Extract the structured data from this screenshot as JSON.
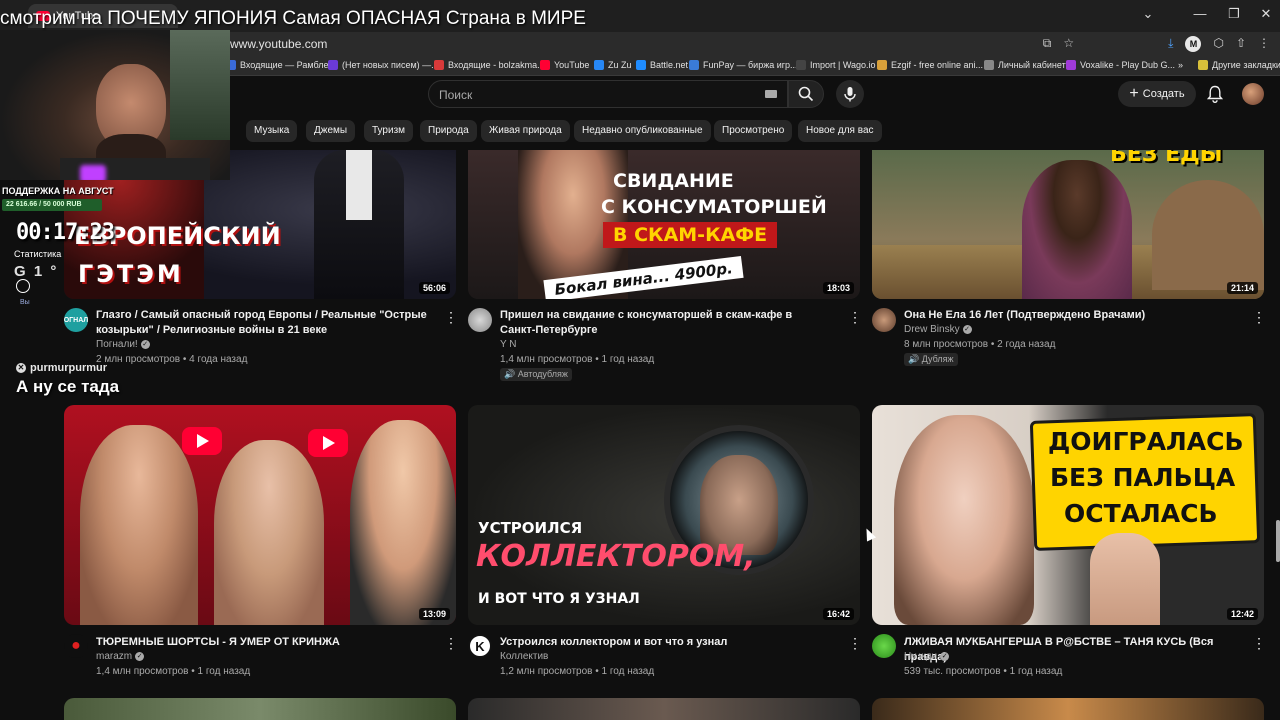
{
  "stream": {
    "title": "смотрим на ПОЧЕМУ ЯПОНИЯ Самая ОПАСНАЯ Страна в МИРЕ",
    "support_label": "ПОДДЕРЖКА НА АВГУСТ",
    "support_value": "22 616.66 / 50 000 RUB",
    "timer": "00:17:23",
    "stats_label": "Статистика",
    "stat_value": "G 1 °",
    "stat_small": "Вы",
    "chat_user": "purmurpurmur",
    "chat_message": "А ну се тада"
  },
  "browser": {
    "tab_title": "YouTube",
    "url": "www.youtube.com",
    "bookmarks": [
      {
        "label": "Входящие — Рамбле...",
        "color": "#3a6bd8"
      },
      {
        "label": "(Нет новых писем) —...",
        "color": "#6b3ad8"
      },
      {
        "label": "Входящие - bolzakma...",
        "color": "#d83a3a"
      },
      {
        "label": "YouTube",
        "color": "#ff0033"
      },
      {
        "label": "Zu Zu",
        "color": "#2787f5"
      },
      {
        "label": "Battle.net",
        "color": "#1f8cff"
      },
      {
        "label": "FunPay — биржа игр...",
        "color": "#3a7bd8"
      },
      {
        "label": "Import | Wago.io",
        "color": "#444444"
      },
      {
        "label": "Ezgif - free online ani...",
        "color": "#d8a03a"
      },
      {
        "label": "Личный кабинет",
        "color": "#888888"
      },
      {
        "label": "Voxalike - Play Dub G...",
        "color": "#a03ad8"
      },
      {
        "label": "Другие закладки",
        "color": "#d8c03a"
      }
    ]
  },
  "youtube": {
    "search_placeholder": "Поиск",
    "create_label": "Создать",
    "chips": [
      "Музыка",
      "Джемы",
      "Туризм",
      "Природа",
      "Живая природа",
      "Недавно опубликованные",
      "Просмотрено",
      "Новое для вас"
    ],
    "videos": [
      {
        "title": "Глазго / Самый опасный город Европы / Реальные \"Острые козырьки\" / Религиозные войны в 21 веке",
        "channel": "Погнали!",
        "meta": "2 млн просмотров • 4 года назад",
        "duration": "56:06",
        "thumb_lines": [
          "ЕВРОПЕЙСКИЙ",
          "ГЭТЭМ"
        ],
        "avatar_text": "ПОГНАЛИ",
        "badge": ""
      },
      {
        "title": "Пришел на свидание с консуматоршей в скам-кафе в Санкт-Петербурге",
        "channel": "Y N",
        "meta": "1,4 млн просмотров • 1 год назад",
        "duration": "18:03",
        "thumb_lines": [
          "СВИДАНИЕ",
          "С КОНСУМАТОРШЕЙ",
          "В СКАМ-КАФЕ",
          "Бокал вина... 4900р."
        ],
        "avatar_text": "",
        "badge": "Автодубляж"
      },
      {
        "title": "Она Не Ела 16 Лет (Подтверждено Врачами)",
        "channel": "Drew Binsky",
        "meta": "8 млн просмотров • 2 года назад",
        "duration": "21:14",
        "thumb_lines": [
          "БЕЗ ЕДЫ"
        ],
        "avatar_text": "",
        "badge": "Дубляж"
      },
      {
        "title": "ТЮРЕМНЫЕ ШОРТСЫ - Я УМЕР ОТ КРИНЖА",
        "channel": "marazm",
        "meta": "1,4 млн просмотров • 1 год назад",
        "duration": "13:09",
        "thumb_lines": [],
        "avatar_text": "",
        "badge": ""
      },
      {
        "title": "Устроился коллектором и вот что я узнал",
        "channel": "Коллектив",
        "meta": "1,2 млн просмотров • 1 год назад",
        "duration": "16:42",
        "thumb_lines": [
          "УСТРОИЛСЯ",
          "КОЛЛЕКТОРОМ,",
          "И ВОТ ЧТО Я УЗНАЛ"
        ],
        "avatar_text": "K",
        "badge": ""
      },
      {
        "title": "ЛЖИВАЯ МУКБАНГЕРША В Р@БСТВЕ – ТАНЯ КУСЬ (Вся правда)",
        "channel": "Ну жди",
        "meta": "539 тыс. просмотров • 1 год назад",
        "duration": "12:42",
        "thumb_lines": [
          "ДОИГРАЛАСЬ",
          "БЕЗ ПАЛЬЦА",
          "ОСТАЛАСЬ"
        ],
        "avatar_text": "",
        "badge": ""
      }
    ]
  },
  "colors": {
    "background": "#0f0f0f",
    "text_primary": "#f1f1f1",
    "text_secondary": "#aaaaaa",
    "chip_bg": "#272727",
    "brand_red": "#ff0033"
  }
}
